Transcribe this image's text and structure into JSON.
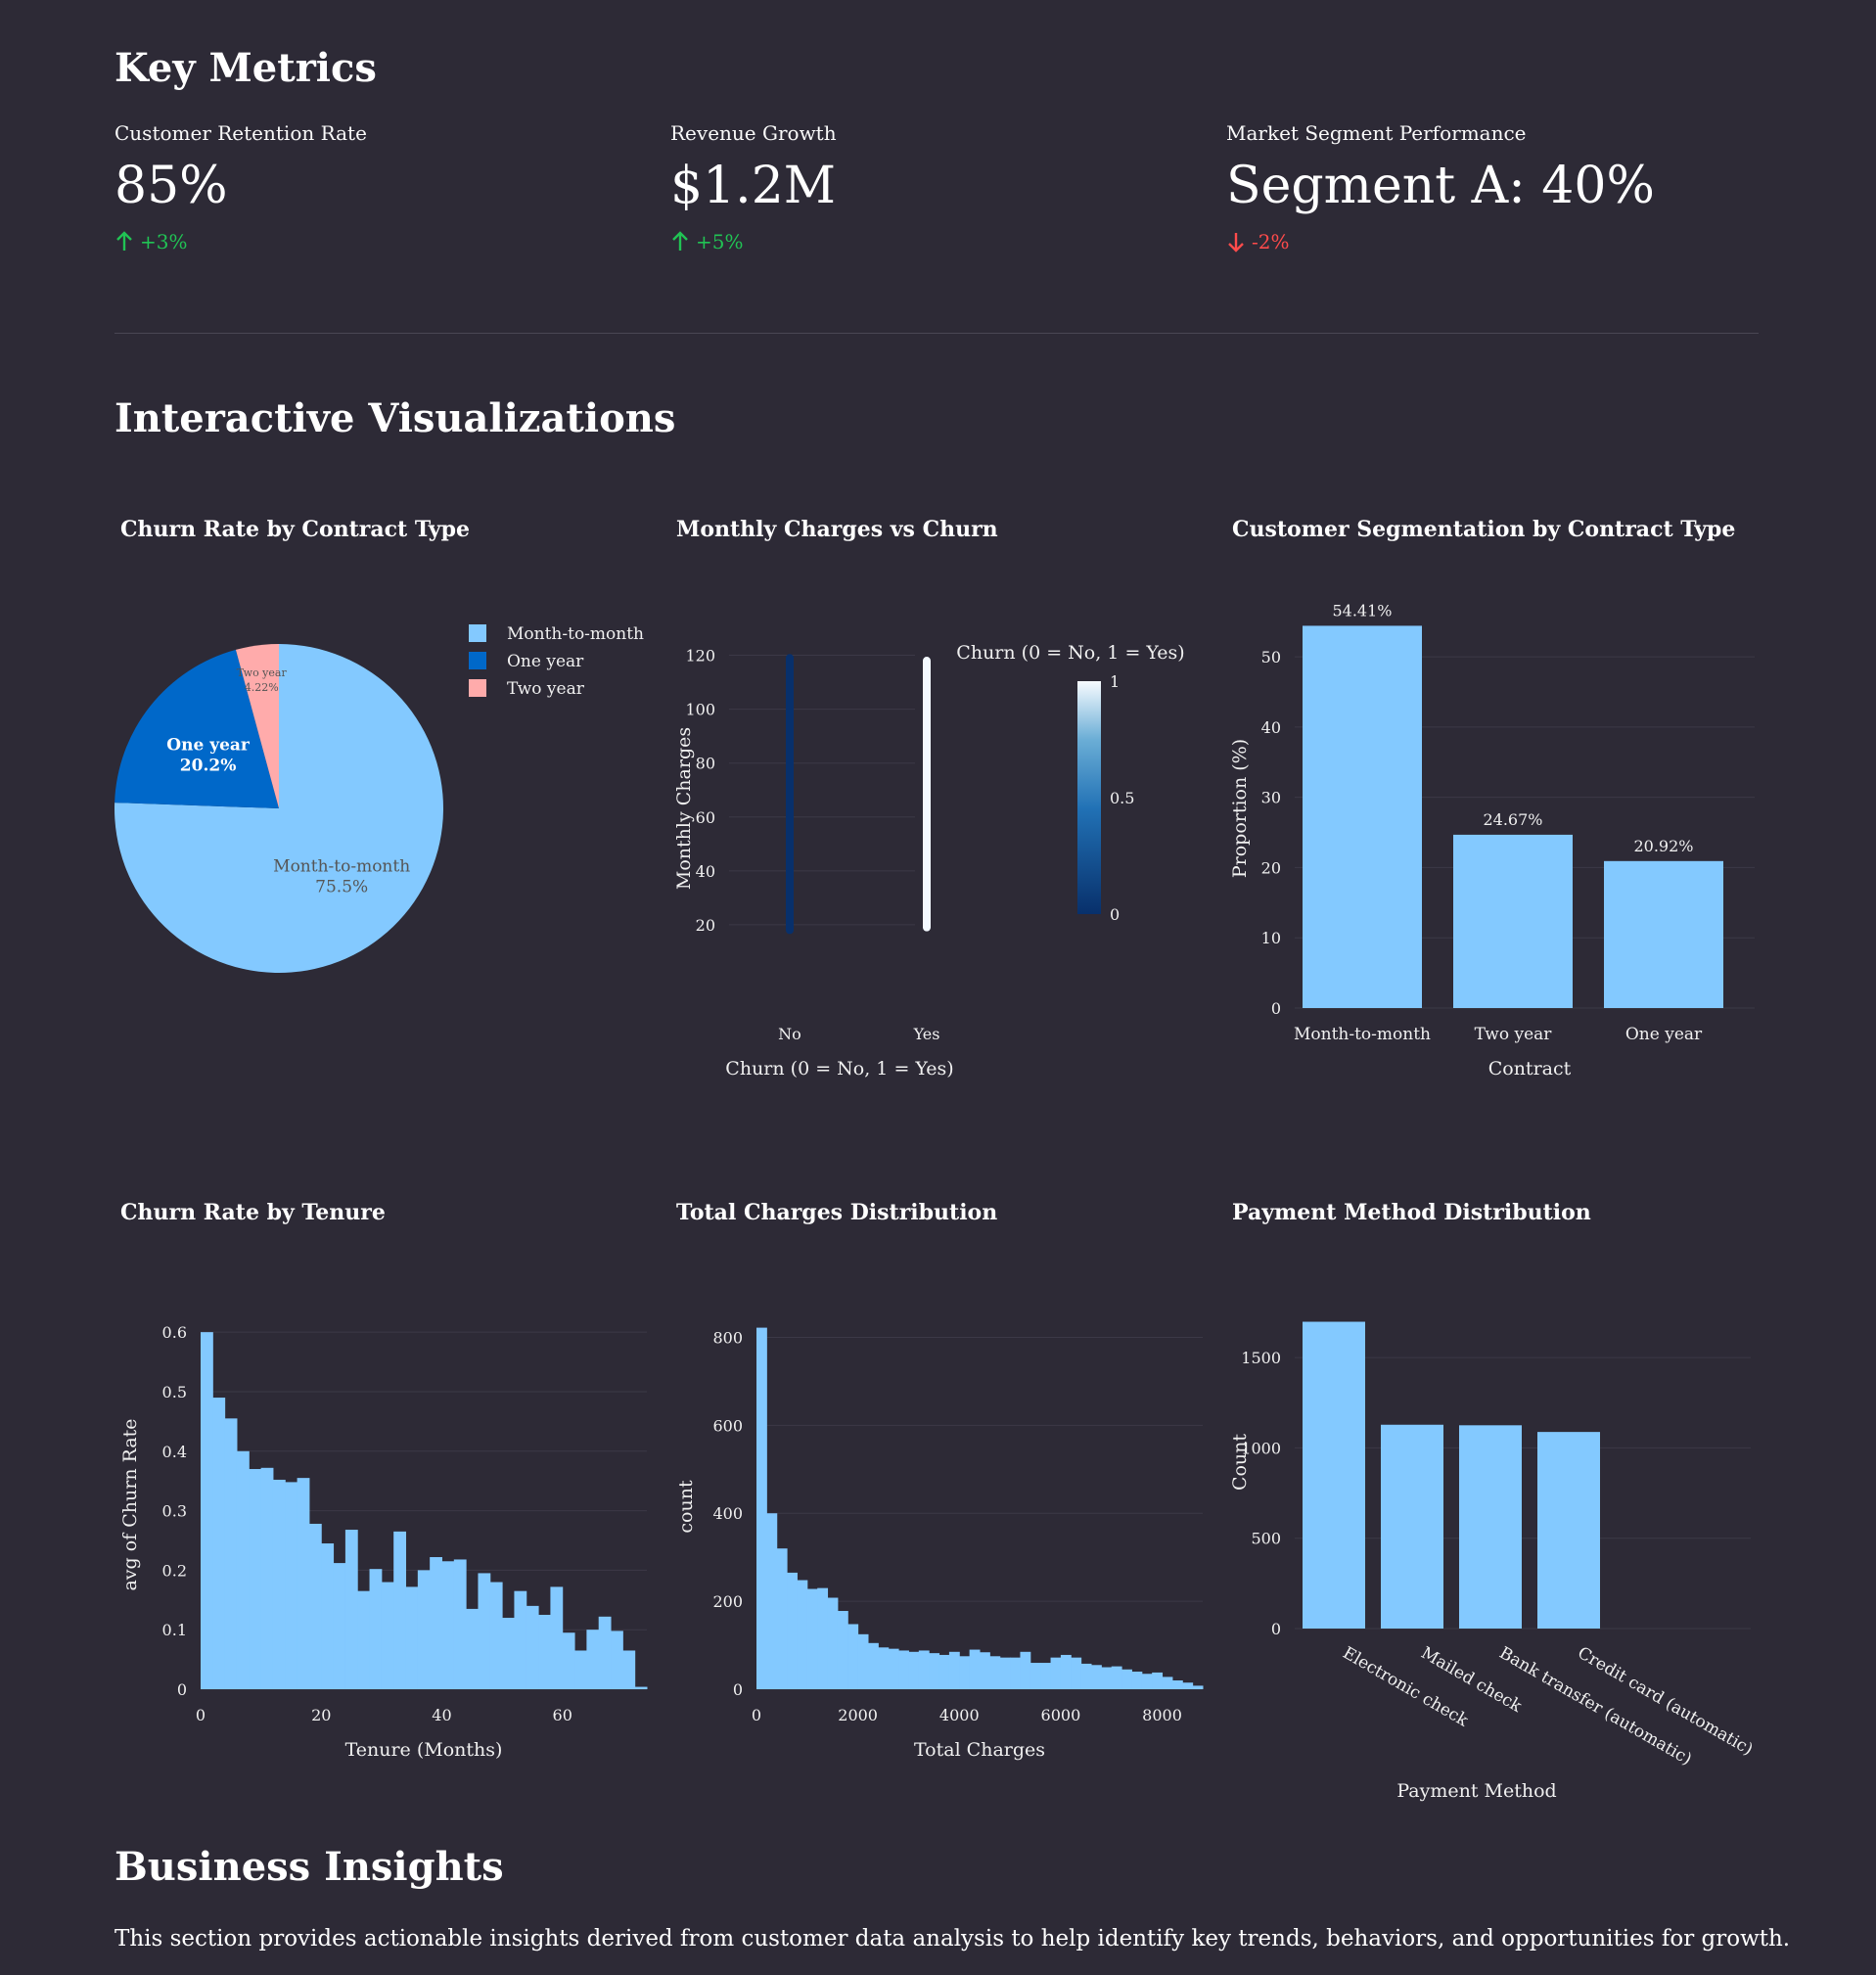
{
  "key_metrics": {
    "heading": "Key Metrics",
    "metrics": [
      {
        "label": "Customer Retention Rate",
        "value": "85%",
        "delta": "+3%",
        "direction": "up"
      },
      {
        "label": "Revenue Growth",
        "value": "$1.2M",
        "delta": "+5%",
        "direction": "up"
      },
      {
        "label": "Market Segment Performance",
        "value": "Segment A: 40%",
        "delta": "-2%",
        "direction": "down"
      }
    ]
  },
  "visualizations": {
    "heading": "Interactive Visualizations"
  },
  "insights": {
    "heading": "Business Insights",
    "text": "This section provides actionable insights derived from customer data analysis to help identify key trends, behaviors, and opportunities for growth."
  },
  "colors": {
    "bar": "#83c9ff",
    "one_year": "#0068c9",
    "two_year": "#ffabab",
    "up": "#21c354",
    "down": "#ff4b4b"
  },
  "chart_data": [
    {
      "type": "pie",
      "title": "Churn Rate by Contract Type",
      "categories": [
        "Month-to-month",
        "One year",
        "Two year"
      ],
      "values": [
        75.5,
        20.2,
        4.22
      ],
      "slice_labels": [
        [
          "Month-to-month",
          "75.5%"
        ],
        [
          "One year",
          "20.2%"
        ],
        [
          "Two year",
          "4.22%"
        ]
      ],
      "colors": [
        "#83c9ff",
        "#0068c9",
        "#ffabab"
      ],
      "legend": "top-right"
    },
    {
      "type": "scatter",
      "title": "Monthly Charges vs Churn",
      "xlabel": "Churn (0 = No, 1 = Yes)",
      "ylabel": "Monthly Charges",
      "x_ticks": [
        "No",
        "Yes"
      ],
      "y_ticks": [
        20,
        40,
        60,
        80,
        100,
        120
      ],
      "ylim": [
        18,
        120
      ],
      "series": [
        {
          "x": "No",
          "y_min": 18,
          "y_max": 119,
          "churn": 0
        },
        {
          "x": "Yes",
          "y_min": 19,
          "y_max": 118,
          "churn": 1
        }
      ],
      "colorbar": {
        "title": "Churn (0 = No, 1 = Yes)",
        "ticks": [
          "0",
          "0.5",
          "1"
        ]
      }
    },
    {
      "type": "bar",
      "title": "Customer Segmentation by Contract Type",
      "categories": [
        "Month-to-month",
        "Two year",
        "One year"
      ],
      "values": [
        54.41,
        24.67,
        20.92
      ],
      "data_labels": [
        "54.41%",
        "24.67%",
        "20.92%"
      ],
      "xlabel": "Contract",
      "ylabel": "Proportion (%)",
      "y_ticks": [
        0,
        10,
        20,
        30,
        40,
        50
      ],
      "ylim": [
        0,
        56
      ]
    },
    {
      "type": "bar",
      "title": "Churn Rate by Tenure",
      "xlabel": "Tenure (Months)",
      "ylabel": "avg of Churn Rate",
      "x_ticks": [
        0,
        20,
        40,
        60
      ],
      "y_ticks": [
        0,
        0.1,
        0.2,
        0.3,
        0.4,
        0.5,
        0.6
      ],
      "bin_width": 2,
      "x": [
        0,
        2,
        4,
        6,
        8,
        10,
        12,
        14,
        16,
        18,
        20,
        22,
        24,
        26,
        28,
        30,
        32,
        34,
        36,
        38,
        40,
        42,
        44,
        46,
        48,
        50,
        52,
        54,
        56,
        58,
        60,
        62,
        64,
        66,
        68,
        70,
        72
      ],
      "values": [
        0.6,
        0.49,
        0.455,
        0.4,
        0.37,
        0.372,
        0.352,
        0.348,
        0.355,
        0.278,
        0.245,
        0.212,
        0.268,
        0.165,
        0.202,
        0.18,
        0.265,
        0.172,
        0.2,
        0.222,
        0.215,
        0.218,
        0.135,
        0.195,
        0.18,
        0.12,
        0.165,
        0.14,
        0.125,
        0.172,
        0.095,
        0.065,
        0.1,
        0.122,
        0.098,
        0.065,
        0.004
      ],
      "xlim": [
        0,
        74
      ],
      "ylim": [
        0,
        0.62
      ]
    },
    {
      "type": "bar",
      "title": "Total Charges Distribution",
      "xlabel": "Total Charges",
      "ylabel": "count",
      "x_ticks": [
        0,
        2000,
        4000,
        6000,
        8000
      ],
      "y_ticks": [
        0,
        200,
        400,
        600,
        800
      ],
      "bin_width": 200,
      "x": [
        0,
        200,
        400,
        600,
        800,
        1000,
        1200,
        1400,
        1600,
        1800,
        2000,
        2200,
        2400,
        2600,
        2800,
        3000,
        3200,
        3400,
        3600,
        3800,
        4000,
        4200,
        4400,
        4600,
        4800,
        5000,
        5200,
        5400,
        5600,
        5800,
        6000,
        6200,
        6400,
        6600,
        6800,
        7000,
        7200,
        7400,
        7600,
        7800,
        8000,
        8200,
        8400,
        8600
      ],
      "values": [
        822,
        400,
        320,
        265,
        248,
        228,
        230,
        208,
        178,
        148,
        125,
        105,
        95,
        92,
        88,
        85,
        88,
        82,
        78,
        85,
        75,
        90,
        84,
        75,
        72,
        72,
        85,
        60,
        60,
        72,
        78,
        72,
        58,
        55,
        50,
        52,
        45,
        40,
        35,
        38,
        28,
        20,
        15,
        8
      ],
      "xlim": [
        0,
        8800
      ],
      "ylim": [
        0,
        830
      ]
    },
    {
      "type": "bar",
      "title": "Payment Method Distribution",
      "categories": [
        "Electronic check",
        "Mailed check",
        "Bank transfer (automatic)",
        "Credit card (automatic)"
      ],
      "values": [
        1698,
        1128,
        1125,
        1088
      ],
      "xlabel": "Payment Method",
      "ylabel": "Count",
      "y_ticks": [
        0,
        500,
        1000,
        1500
      ],
      "ylim": [
        0,
        1700
      ]
    }
  ]
}
